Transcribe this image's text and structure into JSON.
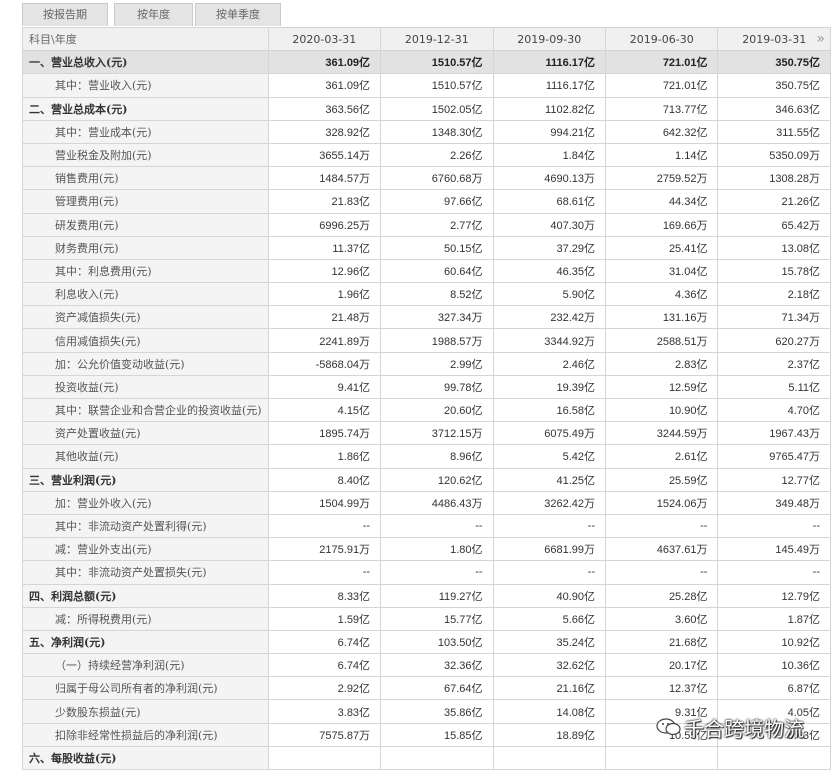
{
  "tabs": [
    "按报告期",
    "按年度",
    "按单季度"
  ],
  "header": {
    "label": "科目\\年度",
    "dates": [
      "2020-03-31",
      "2019-12-31",
      "2019-09-30",
      "2019-06-30",
      "2019-03-31"
    ],
    "more": "»"
  },
  "rows": [
    {
      "label": "一、营业总收入(元)",
      "bold": true,
      "hl": true,
      "indent": false,
      "v": [
        "361.09亿",
        "1510.57亿",
        "1116.17亿",
        "721.01亿",
        "350.75亿"
      ]
    },
    {
      "label": "其中：营业收入(元)",
      "bold": false,
      "hl": false,
      "indent": true,
      "v": [
        "361.09亿",
        "1510.57亿",
        "1116.17亿",
        "721.01亿",
        "350.75亿"
      ]
    },
    {
      "label": "二、营业总成本(元)",
      "bold": true,
      "hl": false,
      "indent": false,
      "v": [
        "363.56亿",
        "1502.05亿",
        "1102.82亿",
        "713.77亿",
        "346.63亿"
      ]
    },
    {
      "label": "其中：营业成本(元)",
      "bold": false,
      "hl": false,
      "indent": true,
      "v": [
        "328.92亿",
        "1348.30亿",
        "994.21亿",
        "642.32亿",
        "311.55亿"
      ]
    },
    {
      "label": "营业税金及附加(元)",
      "bold": false,
      "hl": false,
      "indent": true,
      "v": [
        "3655.14万",
        "2.26亿",
        "1.84亿",
        "1.14亿",
        "5350.09万"
      ]
    },
    {
      "label": "销售费用(元)",
      "bold": false,
      "hl": false,
      "indent": true,
      "v": [
        "1484.57万",
        "6760.68万",
        "4690.13万",
        "2759.52万",
        "1308.28万"
      ]
    },
    {
      "label": "管理费用(元)",
      "bold": false,
      "hl": false,
      "indent": true,
      "v": [
        "21.83亿",
        "97.66亿",
        "68.61亿",
        "44.34亿",
        "21.26亿"
      ]
    },
    {
      "label": "研发费用(元)",
      "bold": false,
      "hl": false,
      "indent": true,
      "v": [
        "6996.25万",
        "2.77亿",
        "407.30万",
        "169.66万",
        "65.42万"
      ]
    },
    {
      "label": "财务费用(元)",
      "bold": false,
      "hl": false,
      "indent": true,
      "v": [
        "11.37亿",
        "50.15亿",
        "37.29亿",
        "25.41亿",
        "13.08亿"
      ]
    },
    {
      "label": "其中：利息费用(元)",
      "bold": false,
      "hl": false,
      "indent": true,
      "v": [
        "12.96亿",
        "60.64亿",
        "46.35亿",
        "31.04亿",
        "15.78亿"
      ]
    },
    {
      "label": "利息收入(元)",
      "bold": false,
      "hl": false,
      "indent": true,
      "v": [
        "1.96亿",
        "8.52亿",
        "5.90亿",
        "4.36亿",
        "2.18亿"
      ]
    },
    {
      "label": "资产减值损失(元)",
      "bold": false,
      "hl": false,
      "indent": true,
      "v": [
        "21.48万",
        "327.34万",
        "232.42万",
        "131.16万",
        "71.34万"
      ]
    },
    {
      "label": "信用减值损失(元)",
      "bold": false,
      "hl": false,
      "indent": true,
      "v": [
        "2241.89万",
        "1988.57万",
        "3344.92万",
        "2588.51万",
        "620.27万"
      ]
    },
    {
      "label": "加：公允价值变动收益(元)",
      "bold": false,
      "hl": false,
      "indent": true,
      "v": [
        "-5868.04万",
        "2.99亿",
        "2.46亿",
        "2.83亿",
        "2.37亿"
      ]
    },
    {
      "label": "投资收益(元)",
      "bold": false,
      "hl": false,
      "indent": true,
      "v": [
        "9.41亿",
        "99.78亿",
        "19.39亿",
        "12.59亿",
        "5.11亿"
      ]
    },
    {
      "label": "其中：联营企业和合营企业的投资收益(元)",
      "bold": false,
      "hl": false,
      "indent": true,
      "v": [
        "4.15亿",
        "20.60亿",
        "16.58亿",
        "10.90亿",
        "4.70亿"
      ]
    },
    {
      "label": "资产处置收益(元)",
      "bold": false,
      "hl": false,
      "indent": true,
      "v": [
        "1895.74万",
        "3712.15万",
        "6075.49万",
        "3244.59万",
        "1967.43万"
      ]
    },
    {
      "label": "其他收益(元)",
      "bold": false,
      "hl": false,
      "indent": true,
      "v": [
        "1.86亿",
        "8.96亿",
        "5.42亿",
        "2.61亿",
        "9765.47万"
      ]
    },
    {
      "label": "三、营业利润(元)",
      "bold": true,
      "hl": false,
      "indent": false,
      "v": [
        "8.40亿",
        "120.62亿",
        "41.25亿",
        "25.59亿",
        "12.77亿"
      ]
    },
    {
      "label": "加：营业外收入(元)",
      "bold": false,
      "hl": false,
      "indent": true,
      "v": [
        "1504.99万",
        "4486.43万",
        "3262.42万",
        "1524.06万",
        "349.48万"
      ]
    },
    {
      "label": "其中：非流动资产处置利得(元)",
      "bold": false,
      "hl": false,
      "indent": true,
      "v": [
        "--",
        "--",
        "--",
        "--",
        "--"
      ]
    },
    {
      "label": "减：营业外支出(元)",
      "bold": false,
      "hl": false,
      "indent": true,
      "v": [
        "2175.91万",
        "1.80亿",
        "6681.99万",
        "4637.61万",
        "145.49万"
      ]
    },
    {
      "label": "其中：非流动资产处置损失(元)",
      "bold": false,
      "hl": false,
      "indent": true,
      "v": [
        "--",
        "--",
        "--",
        "--",
        "--"
      ]
    },
    {
      "label": "四、利润总额(元)",
      "bold": true,
      "hl": false,
      "indent": false,
      "v": [
        "8.33亿",
        "119.27亿",
        "40.90亿",
        "25.28亿",
        "12.79亿"
      ]
    },
    {
      "label": "减：所得税费用(元)",
      "bold": false,
      "hl": false,
      "indent": true,
      "v": [
        "1.59亿",
        "15.77亿",
        "5.66亿",
        "3.60亿",
        "1.87亿"
      ]
    },
    {
      "label": "五、净利润(元)",
      "bold": true,
      "hl": false,
      "indent": false,
      "v": [
        "6.74亿",
        "103.50亿",
        "35.24亿",
        "21.68亿",
        "10.92亿"
      ]
    },
    {
      "label": "（一）持续经营净利润(元)",
      "bold": false,
      "hl": false,
      "indent": true,
      "v": [
        "6.74亿",
        "32.36亿",
        "32.62亿",
        "20.17亿",
        "10.36亿"
      ]
    },
    {
      "label": "归属于母公司所有者的净利润(元)",
      "bold": false,
      "hl": false,
      "indent": true,
      "v": [
        "2.92亿",
        "67.64亿",
        "21.16亿",
        "12.37亿",
        "6.87亿"
      ]
    },
    {
      "label": "少数股东损益(元)",
      "bold": false,
      "hl": false,
      "indent": true,
      "v": [
        "3.83亿",
        "35.86亿",
        "14.08亿",
        "9.31亿",
        "4.05亿"
      ]
    },
    {
      "label": "扣除非经常性损益后的净利润(元)",
      "bold": false,
      "hl": false,
      "indent": true,
      "v": [
        "7575.87万",
        "15.85亿",
        "18.89亿",
        "10.55亿",
        "5.43亿"
      ]
    },
    {
      "label": "六、每股收益(元)",
      "bold": true,
      "hl": false,
      "indent": false,
      "v": [
        "",
        "",
        "",
        "",
        ""
      ]
    }
  ],
  "watermark": "千合跨境物流"
}
